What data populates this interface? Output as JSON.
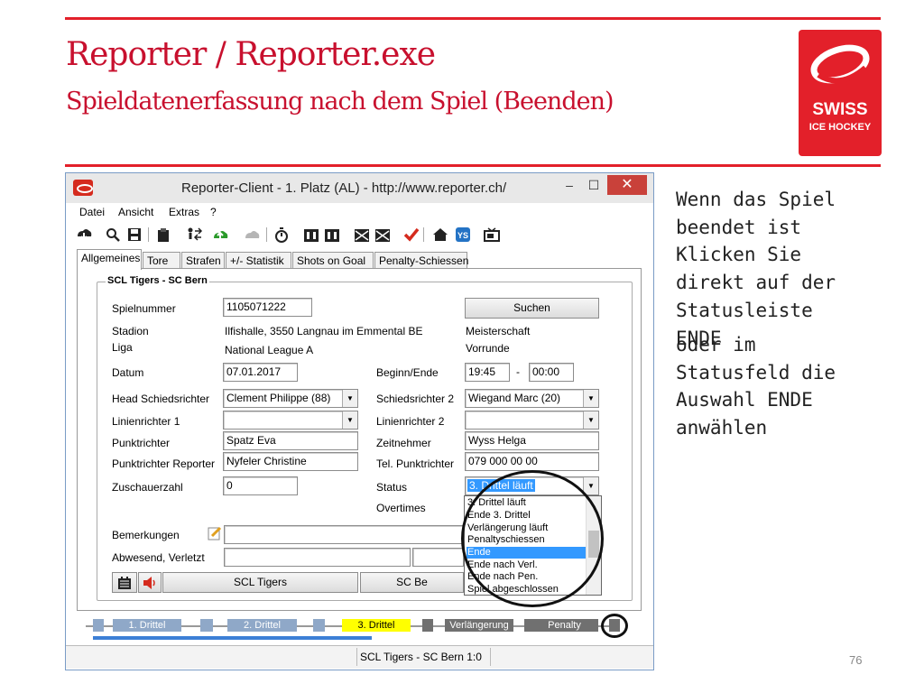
{
  "slide": {
    "title": "Reporter / Reporter.exe",
    "subtitle": "Spieldatenerfassung nach dem Spiel (Beenden)",
    "logo_line1": "SWISS",
    "logo_line2": "ICE HOCKEY",
    "note_part1": "Wenn das Spiel\nbeendet ist\nKlicken Sie\ndirekt auf der\nStatusleiste\nENDE",
    "note_part2": "oder im\nStatusfeld die\nAuswahl ENDE\nanwählen",
    "page_number": "76",
    "brand_color": "#e3202a"
  },
  "window": {
    "title": "Reporter-Client  -  1. Platz (AL)  -  http://www.reporter.ch/",
    "minimize": "–",
    "maximize": "☐",
    "close": "✕"
  },
  "menu": [
    "Datei",
    "Ansicht",
    "Extras",
    "?"
  ],
  "toolbar_icons": [
    "download-icon",
    "search-icon",
    "save-icon",
    "clipboard-icon",
    "substitution-icon",
    "upload-icon",
    "cloud-icon",
    "stopwatch-icon",
    "team-home-icon",
    "team-away-icon",
    "players-home-icon",
    "players-away-icon",
    "check-icon",
    "home-icon",
    "ys-icon",
    "tv-icon"
  ],
  "tabs": [
    "Allgemeines",
    "Tore",
    "Strafen",
    "+/- Statistik",
    "Shots on Goal",
    "Penalty-Schiessen"
  ],
  "group_title": "SCL Tigers - SC Bern",
  "form": {
    "spielnummer_label": "Spielnummer",
    "spielnummer_value": "1105071222",
    "suchen": "Suchen",
    "stadion_label": "Stadion",
    "stadion_value": "Ilfishalle, 3550 Langnau im Emmental BE",
    "meisterschaft": "Meisterschaft",
    "liga_label": "Liga",
    "liga_value": "National League A",
    "vorrunde": "Vorrunde",
    "datum_label": "Datum",
    "datum_value": "07.01.2017",
    "beginn_label": "Beginn/Ende",
    "beginn_value": "19:45",
    "dash": "-",
    "ende_value": "00:00",
    "head_sr_label": "Head Schiedsrichter",
    "head_sr_value": "Clement Philippe (88)",
    "sr2_label": "Schiedsrichter 2",
    "sr2_value": "Wiegand Marc (20)",
    "lr1_label": "Linienrichter 1",
    "lr1_value": "",
    "lr2_label": "Linienrichter 2",
    "lr2_value": "",
    "punktrichter_label": "Punktrichter",
    "punktrichter_value": "Spatz Eva",
    "zeitnehmer_label": "Zeitnehmer",
    "zeitnehmer_value": "Wyss Helga",
    "pr_reporter_label": "Punktrichter Reporter",
    "pr_reporter_value": "Nyfeler Christine",
    "tel_label": "Tel. Punktrichter",
    "tel_value": "079 000 00 00",
    "zuschauer_label": "Zuschauerzahl",
    "zuschauer_value": "0",
    "status_label": "Status",
    "status_value": "3. Drittel läuft",
    "overtimes_label": "Overtimes",
    "bemerkungen_label": "Bemerkungen",
    "abwesend_label": "Abwesend, Verletzt",
    "home_button": "SCL Tigers",
    "away_button": "SC Be"
  },
  "status_options": [
    "3. Drittel läuft",
    "Ende 3. Drittel",
    "Verlängerung läuft",
    "Penaltyschiessen",
    "Ende",
    "Ende nach Verl.",
    "Ende nach Pen.",
    "Spiel abgeschlossen"
  ],
  "status_selected": "Ende",
  "statusbar": {
    "seg1": "1. Drittel",
    "seg2": "2. Drittel",
    "seg3": "3. Drittel",
    "seg4": "Verlängerung",
    "seg5": "Penalty",
    "active_color": "#ffff00",
    "done_color": "#8fa8c8",
    "pending_color": "#707070"
  },
  "bottom_status": "SCL Tigers - SC Bern 1:0"
}
